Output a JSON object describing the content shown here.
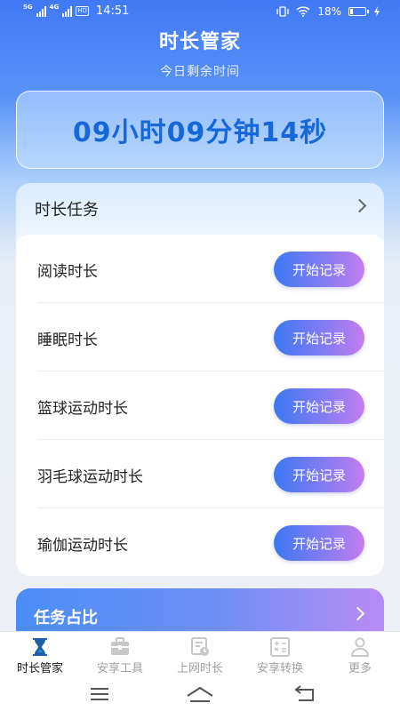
{
  "status_bar": {
    "time": "14:51",
    "network_1": "5G",
    "network_2": "4G",
    "hd": "HD",
    "battery_text": "18%",
    "battery_level": 0.18
  },
  "header": {
    "title": "时长管家",
    "subtitle": "今日剩余时间"
  },
  "timer": {
    "text": "09小时09分钟14秒"
  },
  "task_panel": {
    "title": "时长任务",
    "tasks": [
      {
        "name": "阅读时长",
        "button": "开始记录"
      },
      {
        "name": "睡眠时长",
        "button": "开始记录"
      },
      {
        "name": "篮球运动时长",
        "button": "开始记录"
      },
      {
        "name": "羽毛球运动时长",
        "button": "开始记录"
      },
      {
        "name": "瑜伽运动时长",
        "button": "开始记录"
      }
    ]
  },
  "ratio_card": {
    "title": "任务占比"
  },
  "tabs": [
    {
      "label": "时长管家",
      "icon": "hourglass-icon",
      "active": true
    },
    {
      "label": "安享工具",
      "icon": "toolbox-icon",
      "active": false
    },
    {
      "label": "上网时长",
      "icon": "web-clock-icon",
      "active": false
    },
    {
      "label": "安享转换",
      "icon": "calculator-icon",
      "active": false
    },
    {
      "label": "更多",
      "icon": "person-icon",
      "active": false
    }
  ],
  "colors": {
    "accent": "#1668d8",
    "button_start": "#3c78f2",
    "button_end": "#c37df0"
  }
}
